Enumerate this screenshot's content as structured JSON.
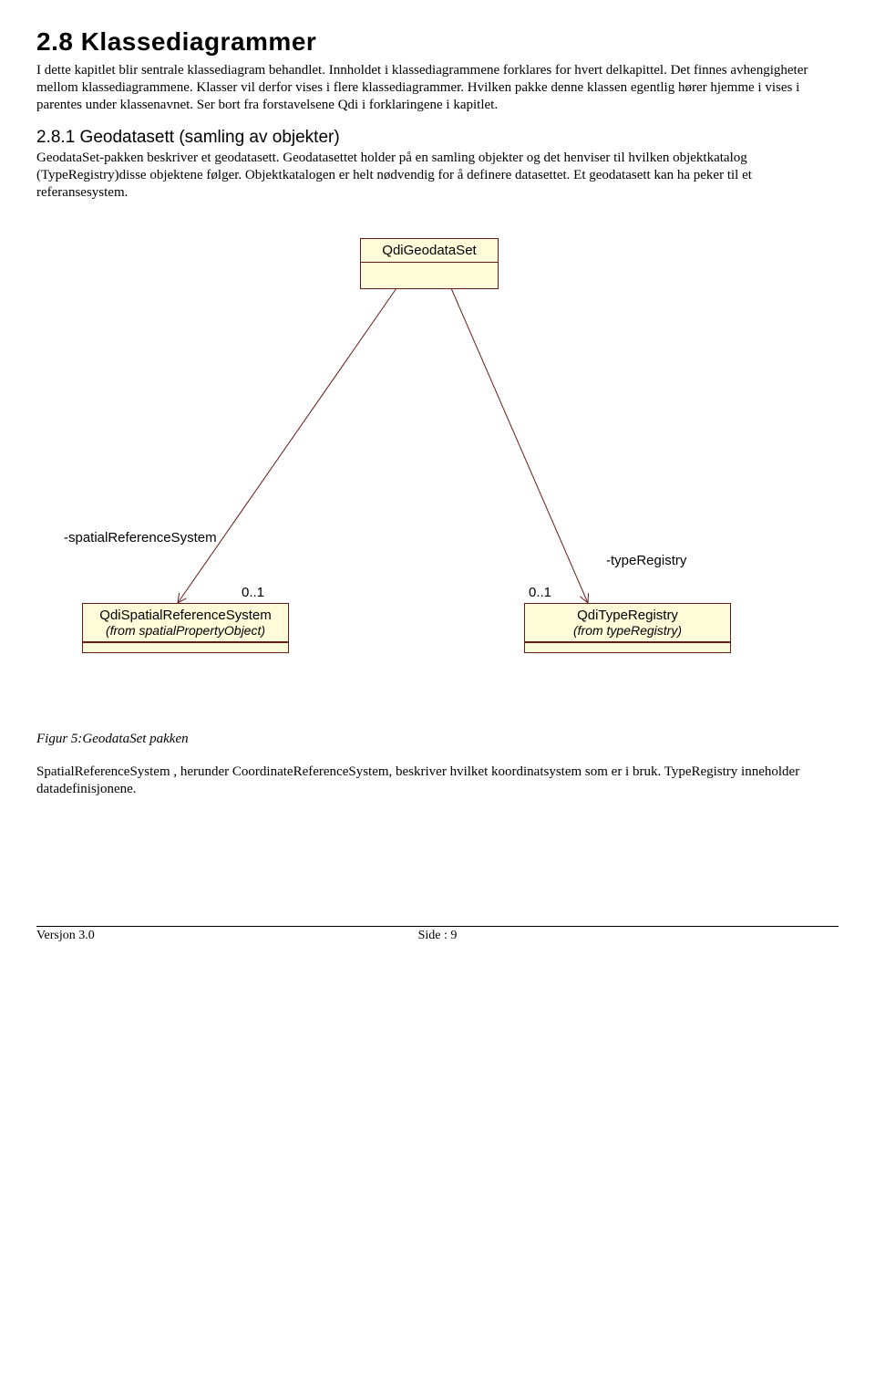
{
  "heading1": "2.8 Klassediagrammer",
  "para1": "I dette kapitlet blir sentrale klassediagram behandlet. Innholdet i klassediagrammene forklares for hvert delkapittel. Det finnes avhengigheter mellom klassediagrammene. Klasser vil derfor vises i flere klassediagrammer. Hvilken pakke denne klassen egentlig hører hjemme i vises i parentes under klassenavnet. Ser bort fra forstavelsene Qdi  i forklaringene i kapitlet.",
  "heading2": "2.8.1   Geodatasett (samling av objekter)",
  "para2": "GeodataSet-pakken beskriver et geodatasett. Geodatasettet holder på en samling objekter og det henviser til hvilken objektkatalog (TypeRegistry)disse objektene følger. Objektkatalogen er helt nødvendig for å definere datasettet. Et geodatasett kan ha peker til et referansesystem.",
  "diagram": {
    "top": {
      "name": "QdiGeodataSet"
    },
    "left": {
      "name": "QdiSpatialReferenceSystem",
      "from": "(from spatialPropertyObject)",
      "role": "-spatialReferenceSystem",
      "mult": "0..1"
    },
    "right": {
      "name": "QdiTypeRegistry",
      "from": "(from typeRegistry)",
      "role": "-typeRegistry",
      "mult": "0..1"
    }
  },
  "figCaption": "Figur 5:GeodataSet pakken",
  "para3": "SpatialReferenceSystem , herunder CoordinateReferenceSystem, beskriver hvilket koordinatsystem som er i bruk. TypeRegistry inneholder datadefinisjonene.",
  "footer": {
    "version": "Versjon 3.0",
    "page": "Side : 9"
  }
}
